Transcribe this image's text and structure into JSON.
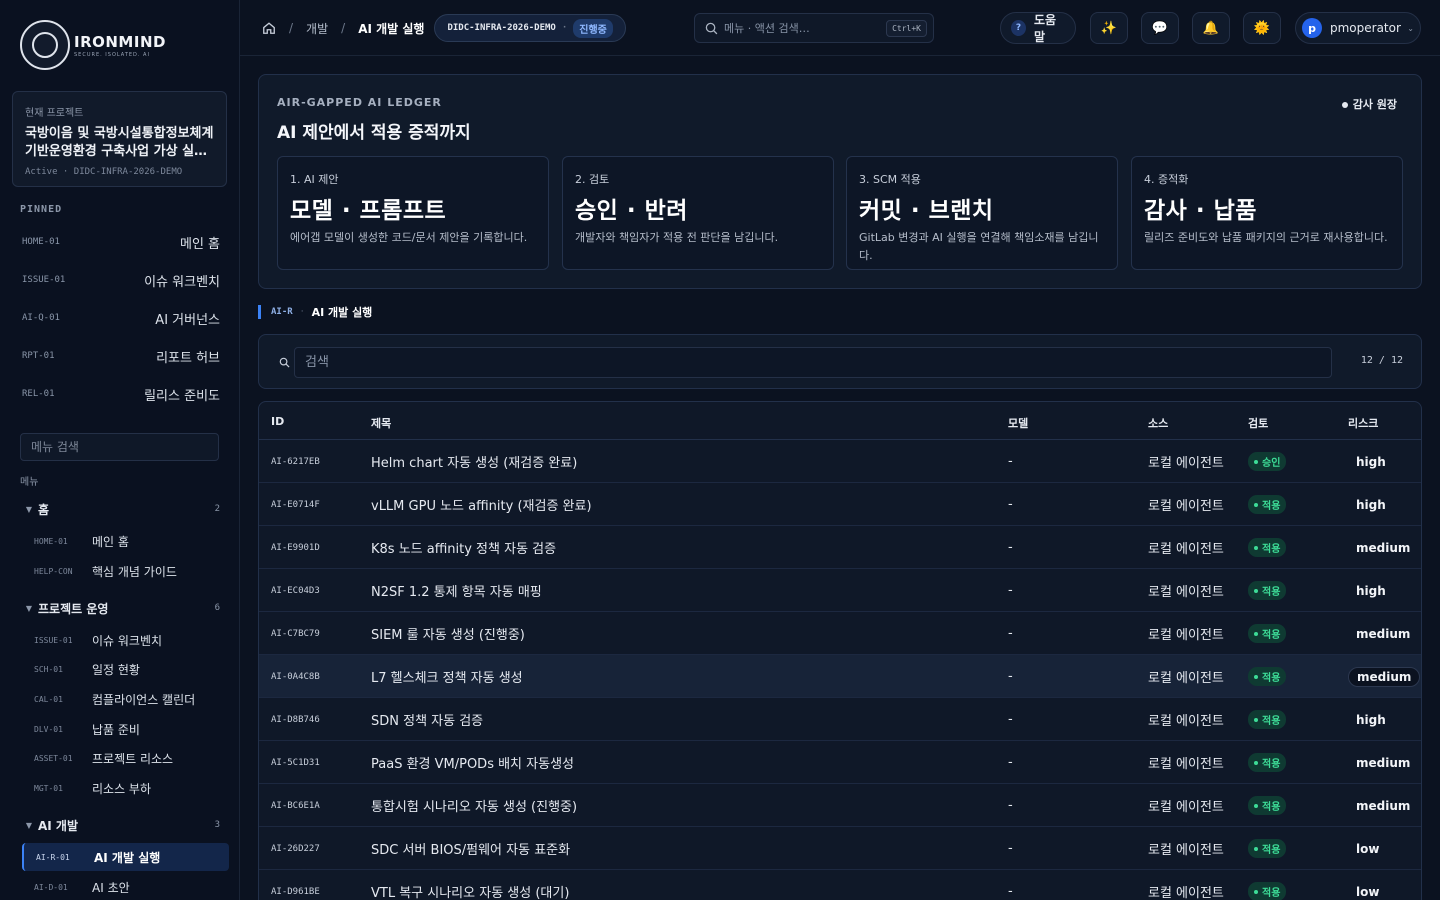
{
  "brand": {
    "name": "IRONMIND",
    "tagline": "SECURE. ISOLATED. AI"
  },
  "project": {
    "label": "현재 프로젝트",
    "title": "국방이음 및 국방시설통합정보체계 기반운영환경 구축사업 가상 실…",
    "status": "Active",
    "code": "DIDC-INFRA-2026-DEMO"
  },
  "pinned": {
    "label": "PINNED",
    "items": [
      {
        "code": "HOME-01",
        "label": "메인 홈"
      },
      {
        "code": "ISSUE-01",
        "label": "이슈 워크벤치"
      },
      {
        "code": "AI-Q-01",
        "label": "AI 거버넌스"
      },
      {
        "code": "RPT-01",
        "label": "리포트 허브"
      },
      {
        "code": "REL-01",
        "label": "릴리스 준비도"
      }
    ]
  },
  "menu": {
    "search_placeholder": "메뉴 검색",
    "label": "메뉴",
    "groups": [
      {
        "name": "홈",
        "count": "2",
        "items": [
          {
            "code": "HOME-01",
            "label": "메인 홈"
          },
          {
            "code": "HELP-CON",
            "label": "핵심 개념 가이드"
          }
        ]
      },
      {
        "name": "프로젝트 운영",
        "count": "6",
        "items": [
          {
            "code": "ISSUE-01",
            "label": "이슈 워크벤치"
          },
          {
            "code": "SCH-01",
            "label": "일정 현황"
          },
          {
            "code": "CAL-01",
            "label": "컴플라이언스 캘린더"
          },
          {
            "code": "DLV-01",
            "label": "납품 준비"
          },
          {
            "code": "ASSET-01",
            "label": "프로젝트 리소스"
          },
          {
            "code": "MGT-01",
            "label": "리소스 부하"
          }
        ]
      },
      {
        "name": "AI 개발",
        "count": "3",
        "items": [
          {
            "code": "AI-R-01",
            "label": "AI 개발 실행"
          },
          {
            "code": "AI-D-01",
            "label": "AI 초안"
          }
        ]
      }
    ]
  },
  "breadcrumb": {
    "level1": "개발",
    "current": "AI 개발 실행",
    "separator": "/"
  },
  "workspace": {
    "code": "DIDC-INFRA-2026-DEMO",
    "separator": "·",
    "status": "진행중"
  },
  "topsearch": {
    "placeholder": "메뉴 · 액션 검색…",
    "shortcut": "Ctrl+K"
  },
  "help": {
    "glyph": "?",
    "label": "도움말"
  },
  "topicons": {
    "sparkle": "✨",
    "chat": "💬",
    "bell": "🔔",
    "theme": "🌞"
  },
  "user": {
    "initial": "p",
    "name": "pmoperator",
    "chevron": "⌄"
  },
  "ledger": {
    "kicker": "AIR-GAPPED AI LEDGER",
    "title": "AI 제안에서 적용 증적까지",
    "badge": "감사 원장",
    "steps": [
      {
        "num": "1. AI 제안",
        "big": "모델 · 프롬프트",
        "desc": "에어갭 모델이 생성한 코드/문서 제안을 기록합니다."
      },
      {
        "num": "2. 검토",
        "big": "승인 · 반려",
        "desc": "개발자와 책임자가 적용 전 판단을 남깁니다."
      },
      {
        "num": "3. SCM 적용",
        "big": "커밋 · 브랜치",
        "desc": "GitLab 변경과 AI 실행을 연결해 책임소재를 남깁니다."
      },
      {
        "num": "4. 증적화",
        "big": "감사 · 납품",
        "desc": "릴리즈 준비도와 납품 패키지의 근거로 재사용합니다."
      }
    ]
  },
  "section": {
    "code": "AI-R",
    "sep": "·",
    "name": "AI 개발 실행"
  },
  "filter": {
    "placeholder": "검색",
    "count": "12 / 12"
  },
  "table": {
    "headers": {
      "id": "ID",
      "title": "제목",
      "model": "모델",
      "source": "소스",
      "review": "검토",
      "risk": "리스크"
    },
    "rows": [
      {
        "id": "AI-6217EB",
        "title": "Helm chart 자동 생성 (재검증 완료)",
        "model": "-",
        "source": "로컬 에이전트",
        "review": "승인",
        "risk": "high"
      },
      {
        "id": "AI-E0714F",
        "title": "vLLM GPU 노드 affinity (재검증 완료)",
        "model": "-",
        "source": "로컬 에이전트",
        "review": "적용",
        "risk": "high"
      },
      {
        "id": "AI-E9901D",
        "title": "K8s 노드 affinity 정책 자동 검증",
        "model": "-",
        "source": "로컬 에이전트",
        "review": "적용",
        "risk": "medium"
      },
      {
        "id": "AI-EC04D3",
        "title": "N2SF 1.2 통제 항목 자동 매핑",
        "model": "-",
        "source": "로컬 에이전트",
        "review": "적용",
        "risk": "high"
      },
      {
        "id": "AI-C7BC79",
        "title": "SIEM 룰 자동 생성 (진행중)",
        "model": "-",
        "source": "로컬 에이전트",
        "review": "적용",
        "risk": "medium"
      },
      {
        "id": "AI-0A4C8B",
        "title": "L7 헬스체크 정책 자동 생성",
        "model": "-",
        "source": "로컬 에이전트",
        "review": "적용",
        "risk": "medium"
      },
      {
        "id": "AI-D8B746",
        "title": "SDN 정책 자동 검증",
        "model": "-",
        "source": "로컬 에이전트",
        "review": "적용",
        "risk": "high"
      },
      {
        "id": "AI-5C1D31",
        "title": "PaaS 환경 VM/PODs 배치 자동생성",
        "model": "-",
        "source": "로컬 에이전트",
        "review": "적용",
        "risk": "medium"
      },
      {
        "id": "AI-BC6E1A",
        "title": "통합시험 시나리오 자동 생성 (진행중)",
        "model": "-",
        "source": "로컬 에이전트",
        "review": "적용",
        "risk": "medium"
      },
      {
        "id": "AI-26D227",
        "title": "SDC 서버 BIOS/펌웨어 자동 표준화",
        "model": "-",
        "source": "로컬 에이전트",
        "review": "적용",
        "risk": "low"
      },
      {
        "id": "AI-D961BE",
        "title": "VTL 복구 시나리오 자동 생성 (대기)",
        "model": "-",
        "source": "로컬 에이전트",
        "review": "적용",
        "risk": "low"
      }
    ]
  },
  "colors": {
    "accent": "#3b82f6",
    "success": "#3ddc97",
    "background": "#0b1220"
  }
}
